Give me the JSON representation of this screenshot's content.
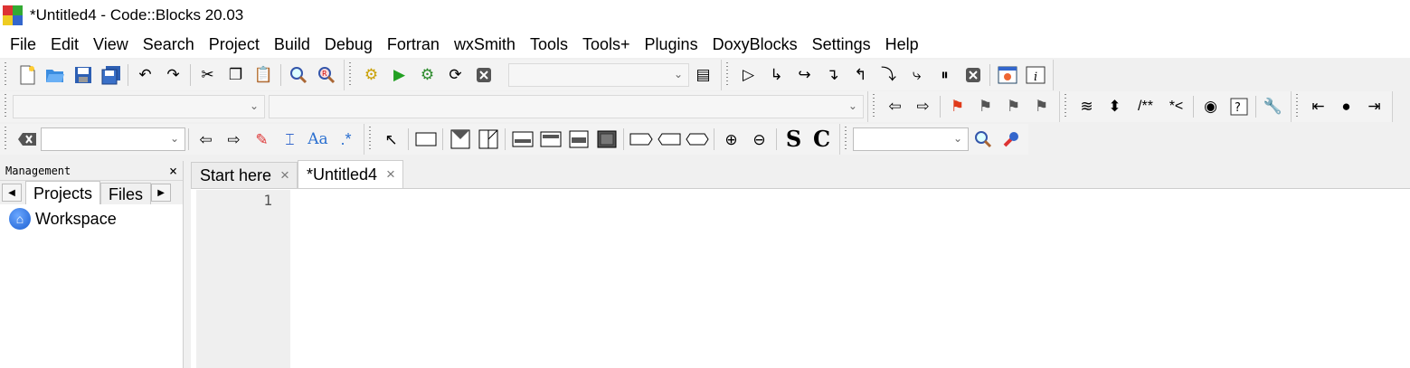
{
  "window": {
    "title": "*Untitled4 - Code::Blocks 20.03"
  },
  "menu": [
    "File",
    "Edit",
    "View",
    "Search",
    "Project",
    "Build",
    "Debug",
    "Fortran",
    "wxSmith",
    "Tools",
    "Tools+",
    "Plugins",
    "DoxyBlocks",
    "Settings",
    "Help"
  ],
  "toolbar_labels": {
    "doxy_comment": "/**",
    "doxy_line": "*<",
    "regex": ".*",
    "match_case": "Aa",
    "sym_s": "S",
    "sym_c": "C"
  },
  "icons": {
    "new": "new-file-icon",
    "open": "open-icon",
    "save": "save-icon",
    "save_all": "save-all-icon",
    "undo": "undo-icon",
    "redo": "redo-icon",
    "cut": "cut-icon",
    "copy": "copy-icon",
    "paste": "paste-icon",
    "find": "find-icon",
    "replace": "replace-icon",
    "build": "gear-icon",
    "run": "play-icon"
  },
  "colors": {
    "accent": "#1c5fd1",
    "run": "#22a022",
    "flag": "#e03a1a"
  },
  "management": {
    "title": "Management",
    "close": "×",
    "tabs": [
      "Projects",
      "Files"
    ],
    "tree": {
      "root": "Workspace"
    }
  },
  "editor": {
    "tabs": [
      {
        "label": "Start here",
        "close": "×",
        "active": false
      },
      {
        "label": "*Untitled4",
        "close": "×",
        "active": true
      }
    ],
    "line_numbers": [
      "1"
    ]
  }
}
